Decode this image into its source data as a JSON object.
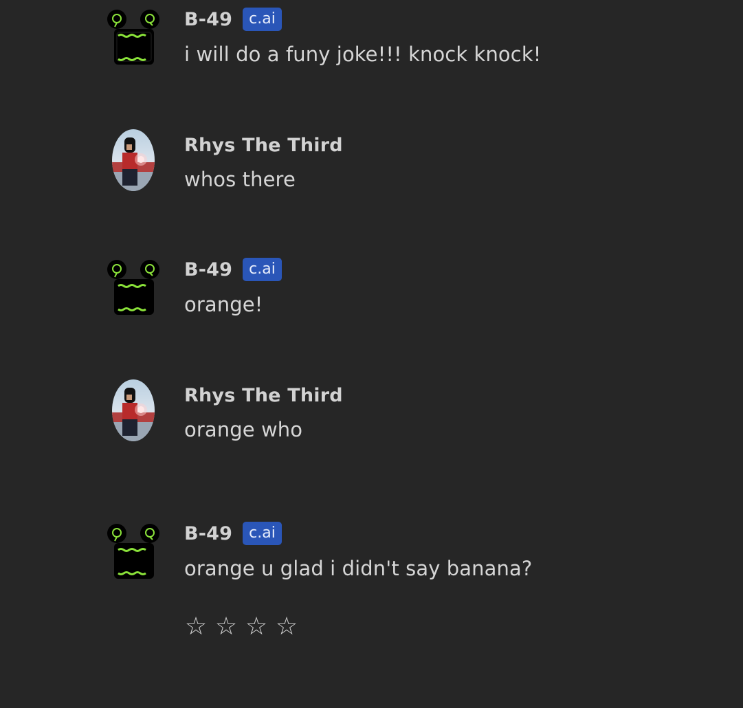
{
  "messages": [
    {
      "author": "B-49",
      "badge": "c.ai",
      "text": "i will do a funy joke!!! knock knock!"
    },
    {
      "author": "Rhys The Third",
      "text": "whos there"
    },
    {
      "author": "B-49",
      "badge": "c.ai",
      "text": "orange!"
    },
    {
      "author": "Rhys The Third",
      "text": "orange who"
    },
    {
      "author": "B-49",
      "badge": "c.ai",
      "text": "orange u glad i didn't say banana?"
    }
  ],
  "rating": {
    "stars": [
      "☆",
      "☆",
      "☆",
      "☆"
    ],
    "value": 0
  },
  "colors": {
    "background": "#262626",
    "badge": "#2a56b8",
    "robot_accent": "#8be33a"
  },
  "icons": {
    "bot_avatar": "robot-avatar-icon",
    "user_avatar": "user-avatar-icon",
    "rating": "star-outline-icon"
  }
}
